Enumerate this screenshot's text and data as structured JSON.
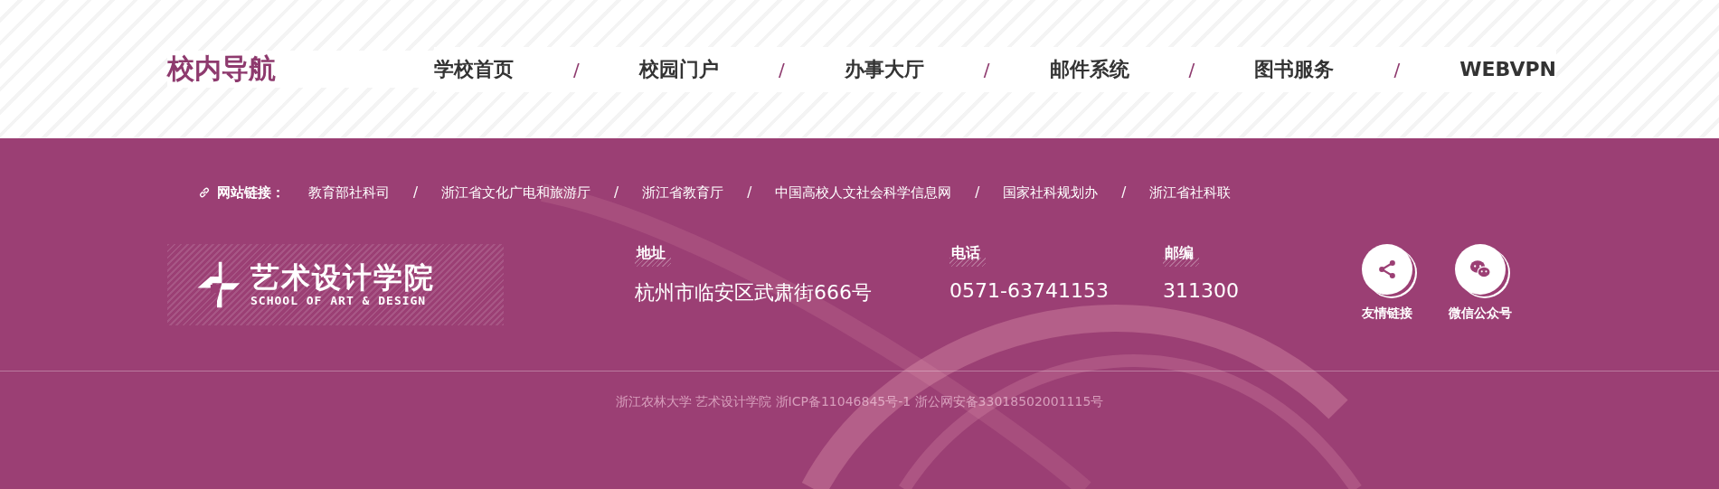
{
  "top_nav": {
    "title": "校内导航",
    "items": [
      {
        "label": "学校首页",
        "separator": "/"
      },
      {
        "label": "校园门户",
        "separator": "/"
      },
      {
        "label": "办事大厅",
        "separator": "/"
      },
      {
        "label": "邮件系统",
        "separator": "/"
      },
      {
        "label": "图书服务",
        "separator": "/"
      },
      {
        "label": "WEBVPN"
      }
    ]
  },
  "links": {
    "label": "网站链接：",
    "items": [
      {
        "label": "教育部社科司",
        "separator": "/"
      },
      {
        "label": "浙江省文化广电和旅游厅",
        "separator": "/"
      },
      {
        "label": "浙江省教育厅",
        "separator": "/"
      },
      {
        "label": "中国高校人文社会科学信息网",
        "separator": "/"
      },
      {
        "label": "国家社科规划办",
        "separator": "/"
      },
      {
        "label": "浙江省社科联"
      }
    ]
  },
  "logo": {
    "name": "艺术设计学院",
    "subtitle": "SCHOOL OF ART & DESIGN"
  },
  "contacts": [
    {
      "label": "地址",
      "value": "杭州市临安区武肃街666号"
    },
    {
      "label": "电话",
      "value": "0571-63741153"
    },
    {
      "label": "邮编",
      "value": "311300"
    }
  ],
  "social": [
    {
      "kind": "share",
      "label": "友情链接"
    },
    {
      "kind": "wechat",
      "label": "微信公众号"
    }
  ],
  "copyright": "浙江农林大学 艺术设计学院 浙ICP备11046845号-1 浙公网安备33018502001115号"
}
